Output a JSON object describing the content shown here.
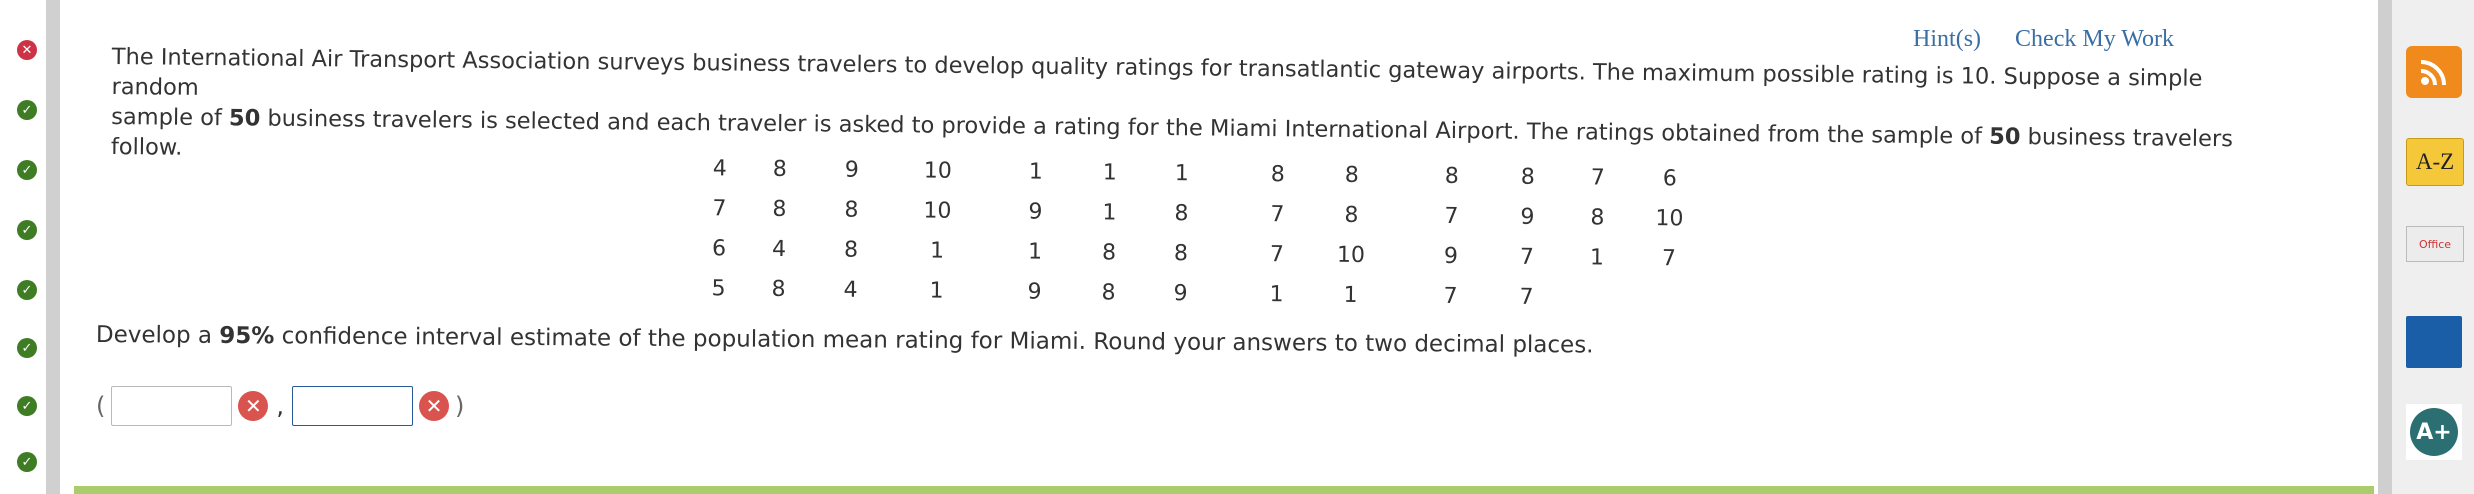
{
  "header": {
    "hint_label": "Hint(s)",
    "check_label": "Check My Work"
  },
  "problem": {
    "text_a": "The International Air Transport Association surveys business travelers to develop quality ratings for transatlantic gateway airports. The maximum possible rating is 10. Suppose a simple random",
    "text_b_pre": "sample of ",
    "sample_size": "50",
    "text_b_post": " business travelers is selected and each traveler is asked to provide a rating for the Miami International Airport. The ratings obtained from the sample of ",
    "sample_size_2": "50",
    "text_b_end": " business travelers follow."
  },
  "ratings": [
    [
      "4",
      "8",
      "9",
      "10",
      "1",
      "1",
      "1",
      "8",
      "8",
      "8",
      "8",
      "7",
      "6"
    ],
    [
      "7",
      "8",
      "8",
      "10",
      "9",
      "1",
      "8",
      "7",
      "8",
      "7",
      "9",
      "8",
      "10"
    ],
    [
      "6",
      "4",
      "8",
      "1",
      "1",
      "8",
      "8",
      "7",
      "10",
      "9",
      "7",
      "1",
      "7"
    ],
    [
      "5",
      "8",
      "4",
      "1",
      "9",
      "8",
      "9",
      "1",
      "1",
      "7",
      "7"
    ]
  ],
  "question": {
    "pre": "Develop a ",
    "confidence": "95%",
    "post": " confidence interval estimate of the population mean rating for Miami. Round your answers to two decimal places."
  },
  "answers": {
    "open": "(",
    "sep": ",",
    "close": ")",
    "lower_value": "",
    "upper_value": ""
  },
  "left_status": [
    "wrong",
    "right",
    "right",
    "right",
    "right",
    "right",
    "right",
    "right"
  ],
  "sidebar": {
    "rss_icon": "rss-icon",
    "az_label": "A-Z",
    "office_label": "Office",
    "aplus_label": "A+"
  },
  "colors": {
    "link": "#3a6fa5",
    "error": "#d9534f",
    "correct": "#3f7d24",
    "rss": "#f08a1c",
    "az": "#f5c83a",
    "book": "#1a5ea8"
  }
}
